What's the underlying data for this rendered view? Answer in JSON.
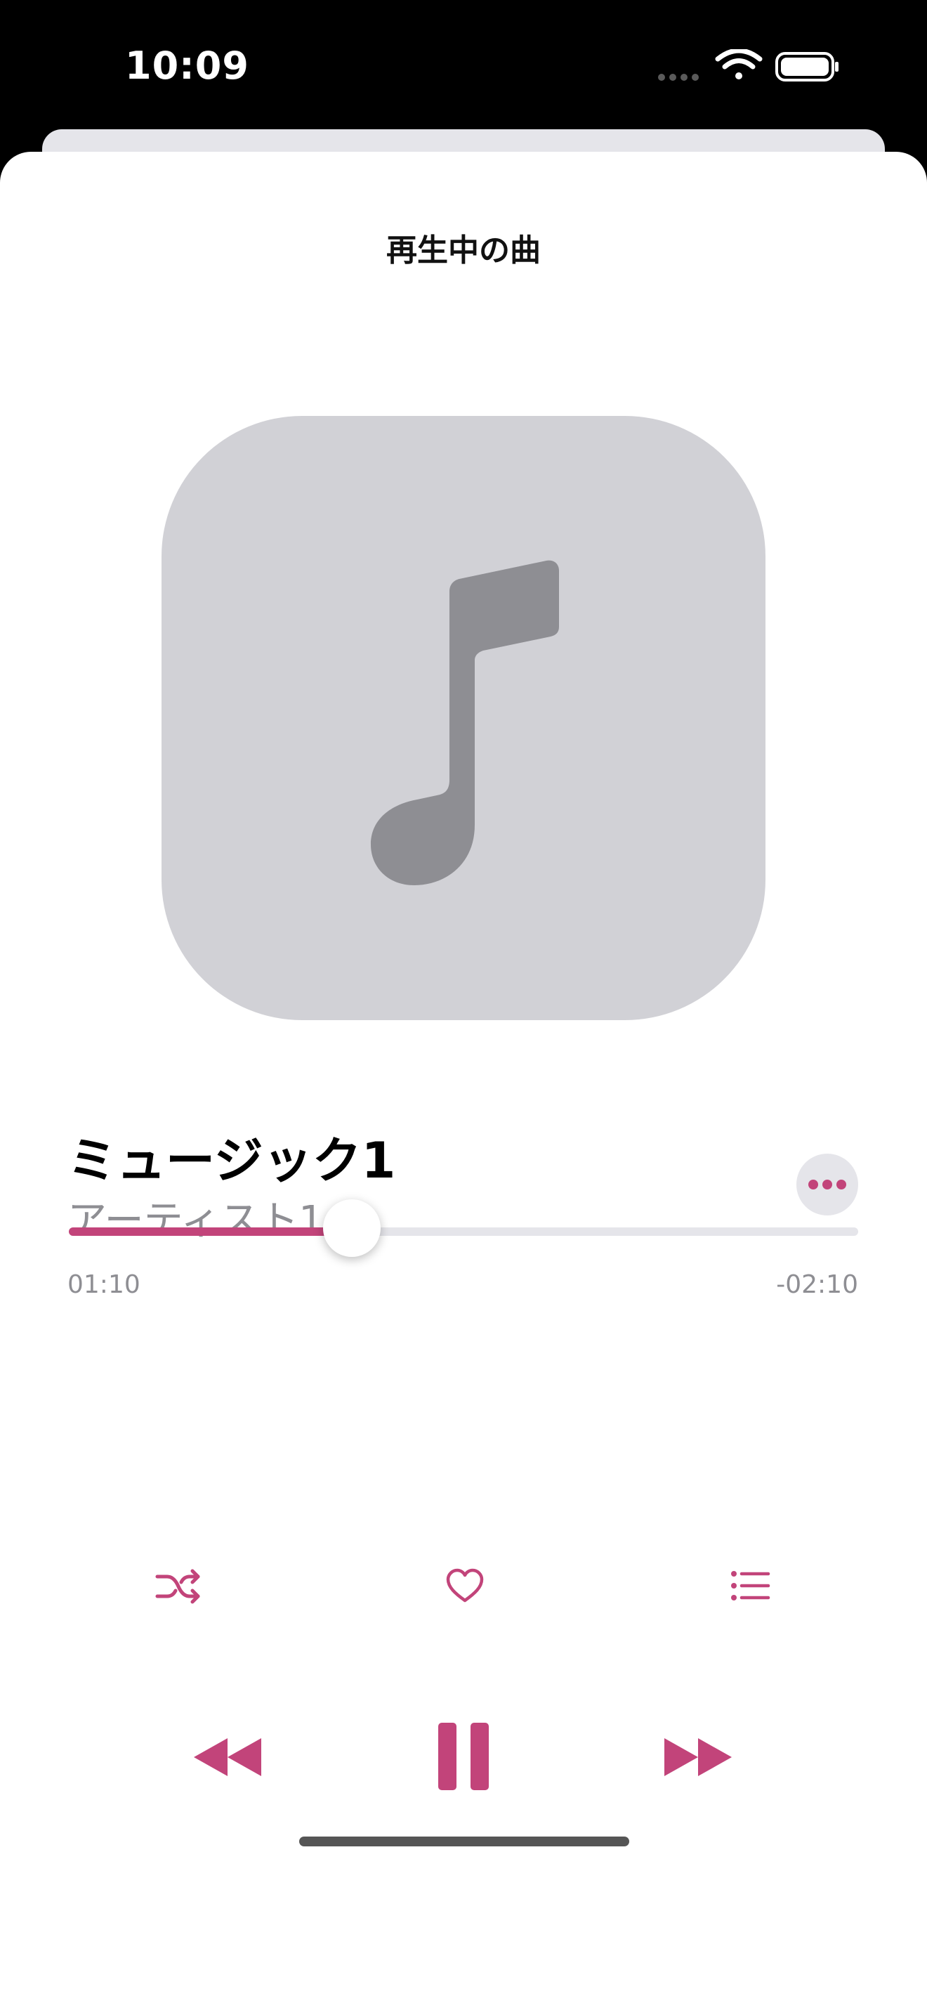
{
  "status_bar": {
    "time": "10:09",
    "icons": [
      "signal-dots-icon",
      "wifi-icon",
      "battery-icon"
    ]
  },
  "sheet": {
    "title": "再生中の曲"
  },
  "artwork": {
    "icon": "music-note-icon"
  },
  "track": {
    "title": "ミュージック1",
    "artist": "アーティスト1"
  },
  "more_button": {
    "icon": "ellipsis-icon"
  },
  "progress": {
    "elapsed": "01:10",
    "remaining": "-02:10",
    "fraction": 0.35
  },
  "actions": {
    "shuffle_icon": "shuffle-icon",
    "favorite_icon": "heart-icon",
    "queue_icon": "list-icon"
  },
  "transport": {
    "rewind_icon": "backward-icon",
    "pause_icon": "pause-icon",
    "forward_icon": "forward-icon"
  },
  "colors": {
    "accent": "#c2447a",
    "artwork_bg": "#d1d1d6",
    "artwork_icon": "#8e8e93",
    "secondary_text": "#8e8e93"
  }
}
